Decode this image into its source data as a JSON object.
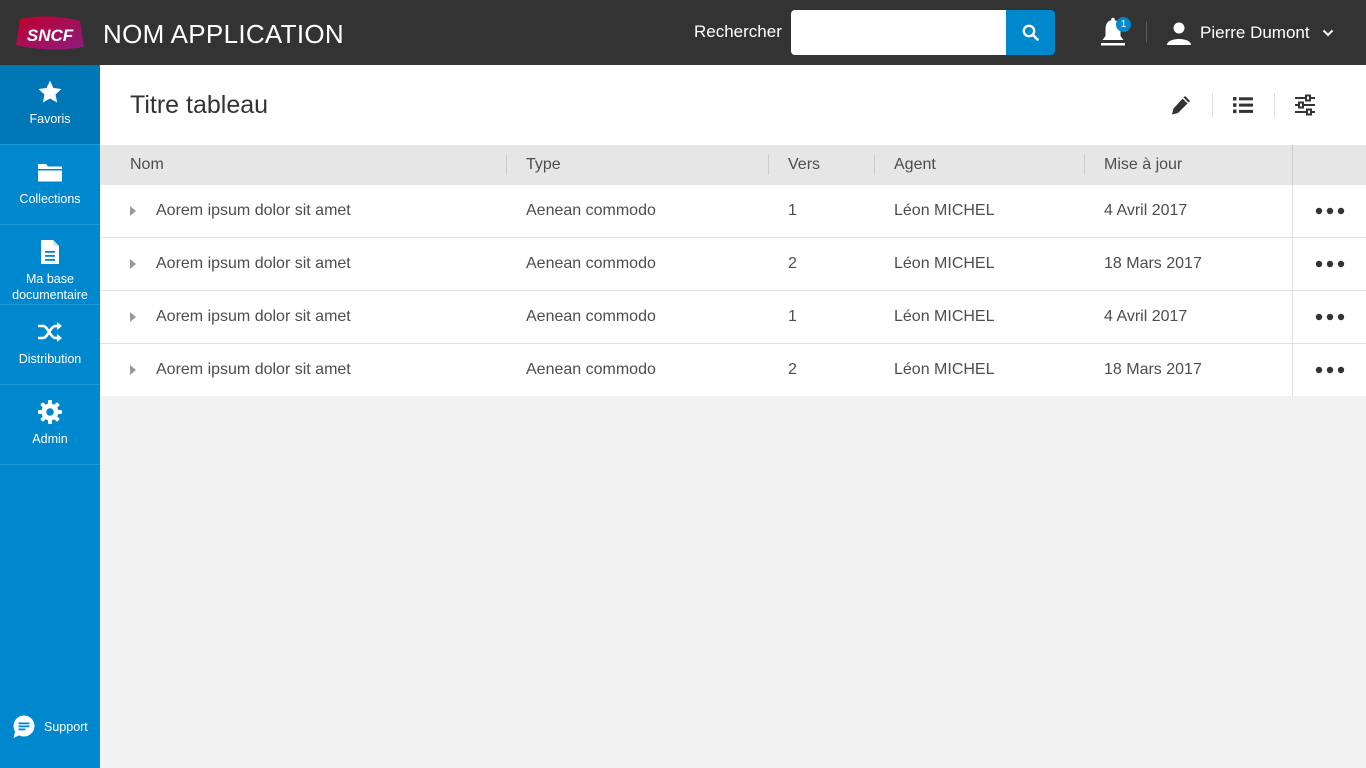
{
  "header": {
    "app_title": "NOM APPLICATION",
    "logo_icon": "sncf-logo",
    "search": {
      "label": "Rechercher",
      "value": "",
      "placeholder": ""
    },
    "notifications": {
      "icon": "bell-icon",
      "count": "1"
    },
    "user": {
      "name": "Pierre Dumont",
      "icon": "user-icon"
    }
  },
  "sidebar": {
    "items": [
      {
        "label": "Favoris",
        "icon": "star-icon",
        "active": true
      },
      {
        "label": "Collections",
        "icon": "folder-icon"
      },
      {
        "label": "Ma base documentaire",
        "icon": "document-icon"
      },
      {
        "label": "Distribution",
        "icon": "shuffle-icon"
      },
      {
        "label": "Admin",
        "icon": "gear-icon"
      }
    ],
    "support": {
      "label": "Support",
      "icon": "chat-icon"
    }
  },
  "main": {
    "title": "Titre tableau",
    "tools": [
      "pencil-icon",
      "list-icon",
      "sliders-icon"
    ],
    "table": {
      "columns": [
        "Nom",
        "Type",
        "Vers",
        "Agent",
        "Mise à jour"
      ],
      "rows": [
        {
          "nom": "Aorem ipsum dolor sit amet",
          "type": "Aenean commodo",
          "vers": "1",
          "agent": "Léon MICHEL",
          "date": "4 Avril 2017"
        },
        {
          "nom": "Aorem ipsum dolor sit amet",
          "type": "Aenean commodo",
          "vers": "2",
          "agent": "Léon MICHEL",
          "date": "18 Mars 2017"
        },
        {
          "nom": "Aorem ipsum dolor sit amet",
          "type": "Aenean commodo",
          "vers": "1",
          "agent": "Léon MICHEL",
          "date": "4 Avril 2017"
        },
        {
          "nom": "Aorem ipsum dolor sit amet",
          "type": "Aenean commodo",
          "vers": "2",
          "agent": "Léon MICHEL",
          "date": "18 Mars 2017"
        }
      ]
    }
  },
  "colors": {
    "header_bg": "#333333",
    "sidebar_bg": "#0088ce",
    "sidebar_active_bg": "#0078b8",
    "accent": "#0088ce",
    "page_bg": "#f2f2f2"
  }
}
